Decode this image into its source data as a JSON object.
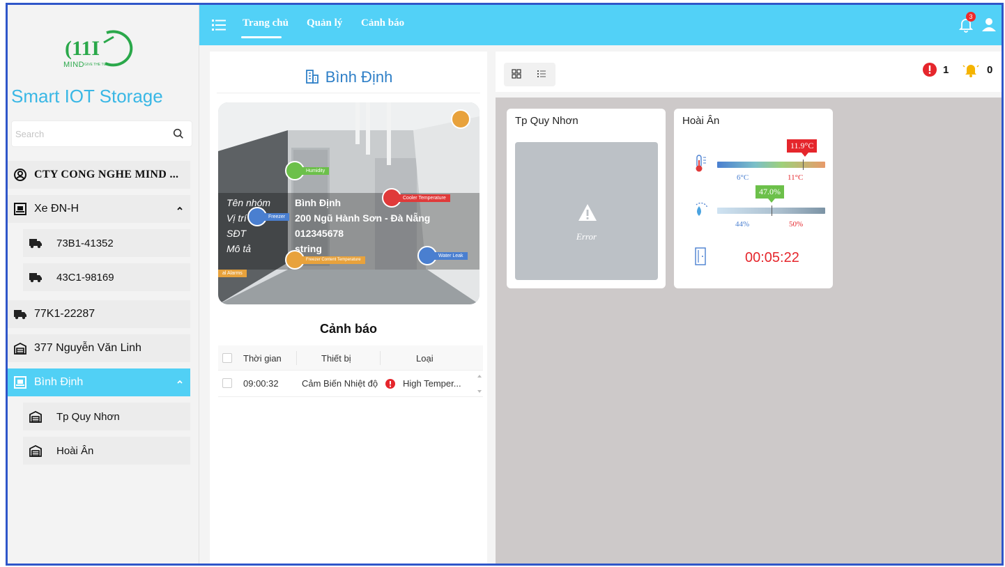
{
  "sidebar": {
    "logo_text": "MIND",
    "logo_sub": "GIVE THE TOP",
    "app_title": "Smart IOT Storage",
    "search_placeholder": "Search",
    "company": "CTY CONG NGHE MIND ...",
    "items": [
      {
        "label": "Xe ĐN-H",
        "icon": "vehicle-group-icon",
        "expanded": true
      },
      {
        "label": "73B1-41352",
        "icon": "truck-icon"
      },
      {
        "label": "43C1-98169",
        "icon": "truck-icon"
      },
      {
        "label": "77K1-22287",
        "icon": "truck-icon"
      },
      {
        "label": "377 Nguyễn Văn Linh",
        "icon": "warehouse-icon"
      },
      {
        "label": "Bình Định",
        "icon": "vehicle-group-icon",
        "active": true
      },
      {
        "label": "Tp Quy Nhơn",
        "icon": "warehouse-icon"
      },
      {
        "label": "Hoài Ân",
        "icon": "warehouse-icon"
      }
    ]
  },
  "topbar": {
    "tabs": [
      "Trang chủ",
      "Quản lý",
      "Cảnh báo"
    ],
    "active_tab": "Trang chủ",
    "notification_count": "3"
  },
  "location": {
    "title": "Bình Định",
    "info": [
      {
        "key": "Tên nhóm",
        "value": "Bình Định"
      },
      {
        "key": "Vị trí",
        "value": "200 Ngũ Hành Sơn - Đà Nẵng"
      },
      {
        "key": "SĐT",
        "value": "012345678"
      },
      {
        "key": "Mô tả",
        "value": "string"
      }
    ],
    "sensors": [
      "Humidity",
      "Cooler Temperature",
      "Freezer",
      "Freezer Content Temperature",
      "Water Leak",
      "al Alarms"
    ]
  },
  "alerts": {
    "title": "Cảnh báo",
    "columns": [
      "Thời gian",
      "Thiết bị",
      "Loại"
    ],
    "rows": [
      {
        "time": "09:00:32",
        "device": "Cảm Biến Nhiệt độ",
        "type": "High Temper..."
      }
    ]
  },
  "counters": {
    "errors": "1",
    "warnings": "0"
  },
  "cards": [
    {
      "title": "Tp Quy Nhơn",
      "status": "Error"
    },
    {
      "title": "Hoài Ân",
      "temperature": {
        "value": "11.9°C",
        "min": "6°C",
        "max": "11°C"
      },
      "humidity": {
        "value": "47.0%",
        "min": "44%",
        "max": "50%"
      },
      "door_timer": "00:05:22"
    }
  ],
  "colors": {
    "topbar": "#52d1f7",
    "active": "#51d0f5",
    "accent_text": "#2e7fc7",
    "alert_red": "#e5262c",
    "warning_yellow": "#f5b400"
  }
}
